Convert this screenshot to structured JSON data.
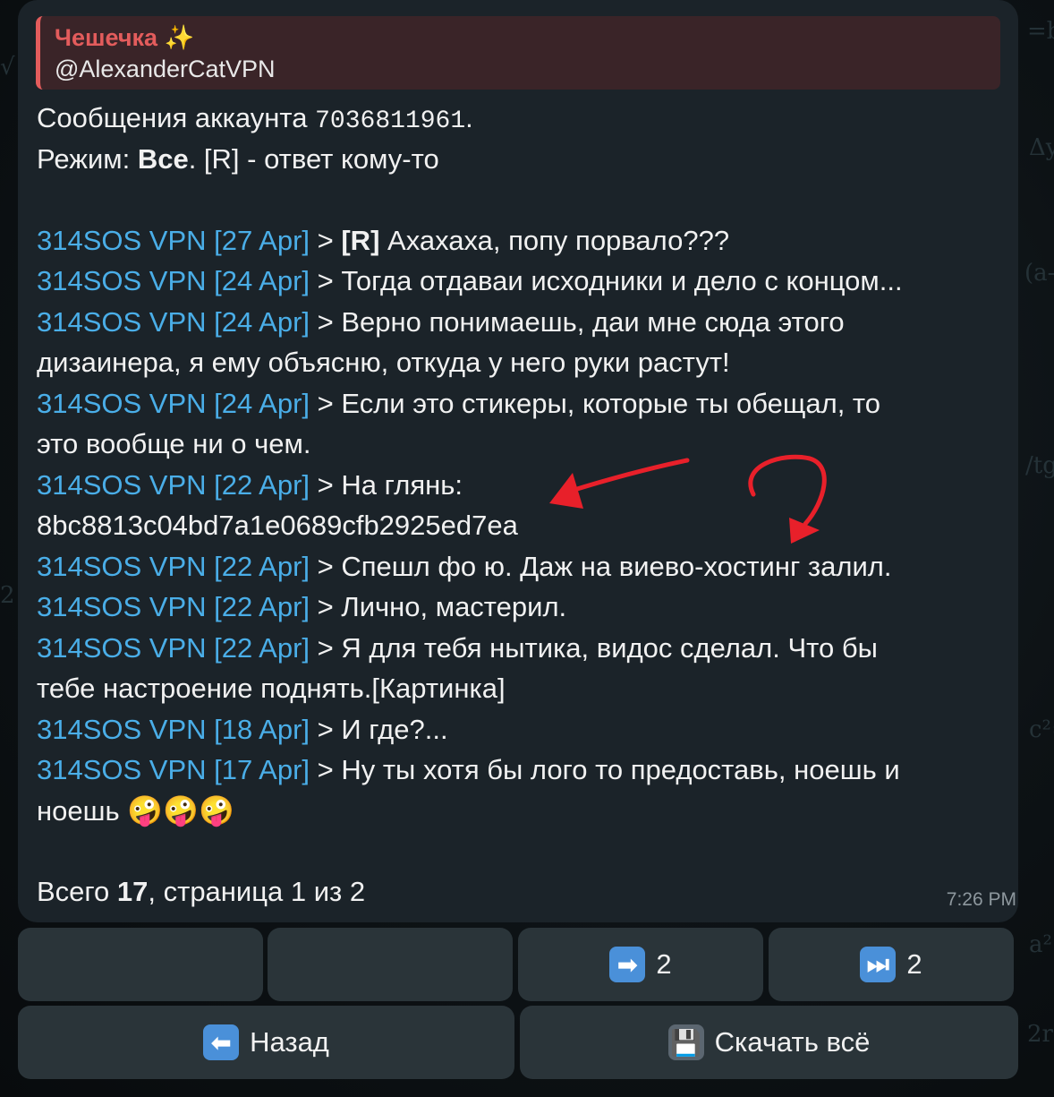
{
  "quote": {
    "name": "Чешечка ✨",
    "handle": "@AlexanderCatVPN"
  },
  "header": {
    "line1_prefix": "Сообщения аккаунта ",
    "account_id": "7036811961",
    "line1_suffix": ".",
    "mode_label": "Режим: ",
    "mode_value": "Все",
    "mode_suffix": ". [R] - ответ кому-то"
  },
  "messages": [
    {
      "sender": "314SOS VPN [27 Apr]",
      "sep": " > ",
      "tag": "[R]",
      "text": " Ахахаха, попу порвало???"
    },
    {
      "sender": "314SOS VPN [24 Apr]",
      "sep": " > ",
      "text": "Тогда отдаваи исходники и дело с концом..."
    },
    {
      "sender": "314SOS VPN [24 Apr]",
      "sep": " > ",
      "text": "Верно понимаешь, даи мне сюда этого",
      "cont": "дизаинера, я ему объясню, откуда у него руки растут!"
    },
    {
      "sender": "314SOS VPN [24 Apr]",
      "sep": " > ",
      "text": "Если это стикеры, которые ты обещал, то",
      "cont": "это вообще ни о чем."
    },
    {
      "sender": "314SOS VPN [22 Apr]",
      "sep": " > ",
      "text": "На глянь:",
      "cont": "8bc8813c04bd7a1e0689cfb2925ed7ea"
    },
    {
      "sender": "314SOS VPN [22 Apr]",
      "sep": " > ",
      "text": "Спешл фо ю. Даж на виево-хостинг залил."
    },
    {
      "sender": "314SOS VPN [22 Apr]",
      "sep": " > ",
      "text": "Лично, мастерил."
    },
    {
      "sender": "314SOS VPN [22 Apr]",
      "sep": " > ",
      "text": "Я для тебя нытика, видос сделал. Что бы",
      "cont": "тебе настроение поднять.[Картинка]"
    },
    {
      "sender": "314SOS VPN [18 Apr]",
      "sep": " > ",
      "text": "И где?..."
    },
    {
      "sender": "314SOS VPN [17 Apr]",
      "sep": " > ",
      "text": "Ну ты хотя бы лого то предоставь, ноешь и",
      "cont": "ноешь",
      "emoji": "🤪🤪🤪"
    }
  ],
  "footer": {
    "total_label": "Всего ",
    "total": "17",
    "page_text": ", страница 1 из 2"
  },
  "time": "7:26 PM",
  "buttons": {
    "next_icon": "➡",
    "next_label": "2",
    "last_icon": "⏭",
    "last_label": "2",
    "back_icon": "⬅",
    "back_label": "Назад",
    "download_icon": "💾",
    "download_label": "Скачать всё"
  },
  "colors": {
    "link": "#4aaee8",
    "quote_accent": "#e35c5c",
    "annotation": "#e8202a"
  }
}
